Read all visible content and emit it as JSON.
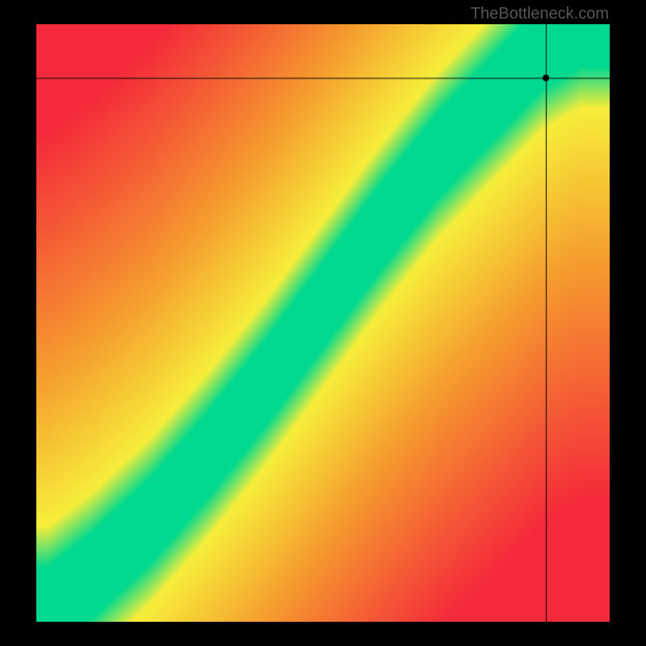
{
  "watermark": "TheBottleneck.com",
  "chart_data": {
    "type": "heatmap",
    "title": "",
    "xlabel": "",
    "ylabel": "",
    "xlim": [
      0,
      100
    ],
    "ylim": [
      0,
      100
    ],
    "crosshair": {
      "x": 89,
      "y": 91
    },
    "marker": {
      "x": 89,
      "y": 91
    },
    "optimal_ridge": {
      "description": "Green band runs from bottom-left to top-right with superlinear curve",
      "points_xy": [
        [
          2,
          2
        ],
        [
          10,
          8
        ],
        [
          20,
          17
        ],
        [
          30,
          28
        ],
        [
          40,
          40
        ],
        [
          50,
          53
        ],
        [
          60,
          66
        ],
        [
          70,
          78
        ],
        [
          80,
          88
        ],
        [
          88,
          96
        ],
        [
          95,
          100
        ]
      ],
      "band_width_pct": 6
    },
    "colormap": {
      "optimal": "#00d98f",
      "near": "#f7ee3a",
      "mid": "#f59b2e",
      "far": "#f42a3a"
    }
  }
}
